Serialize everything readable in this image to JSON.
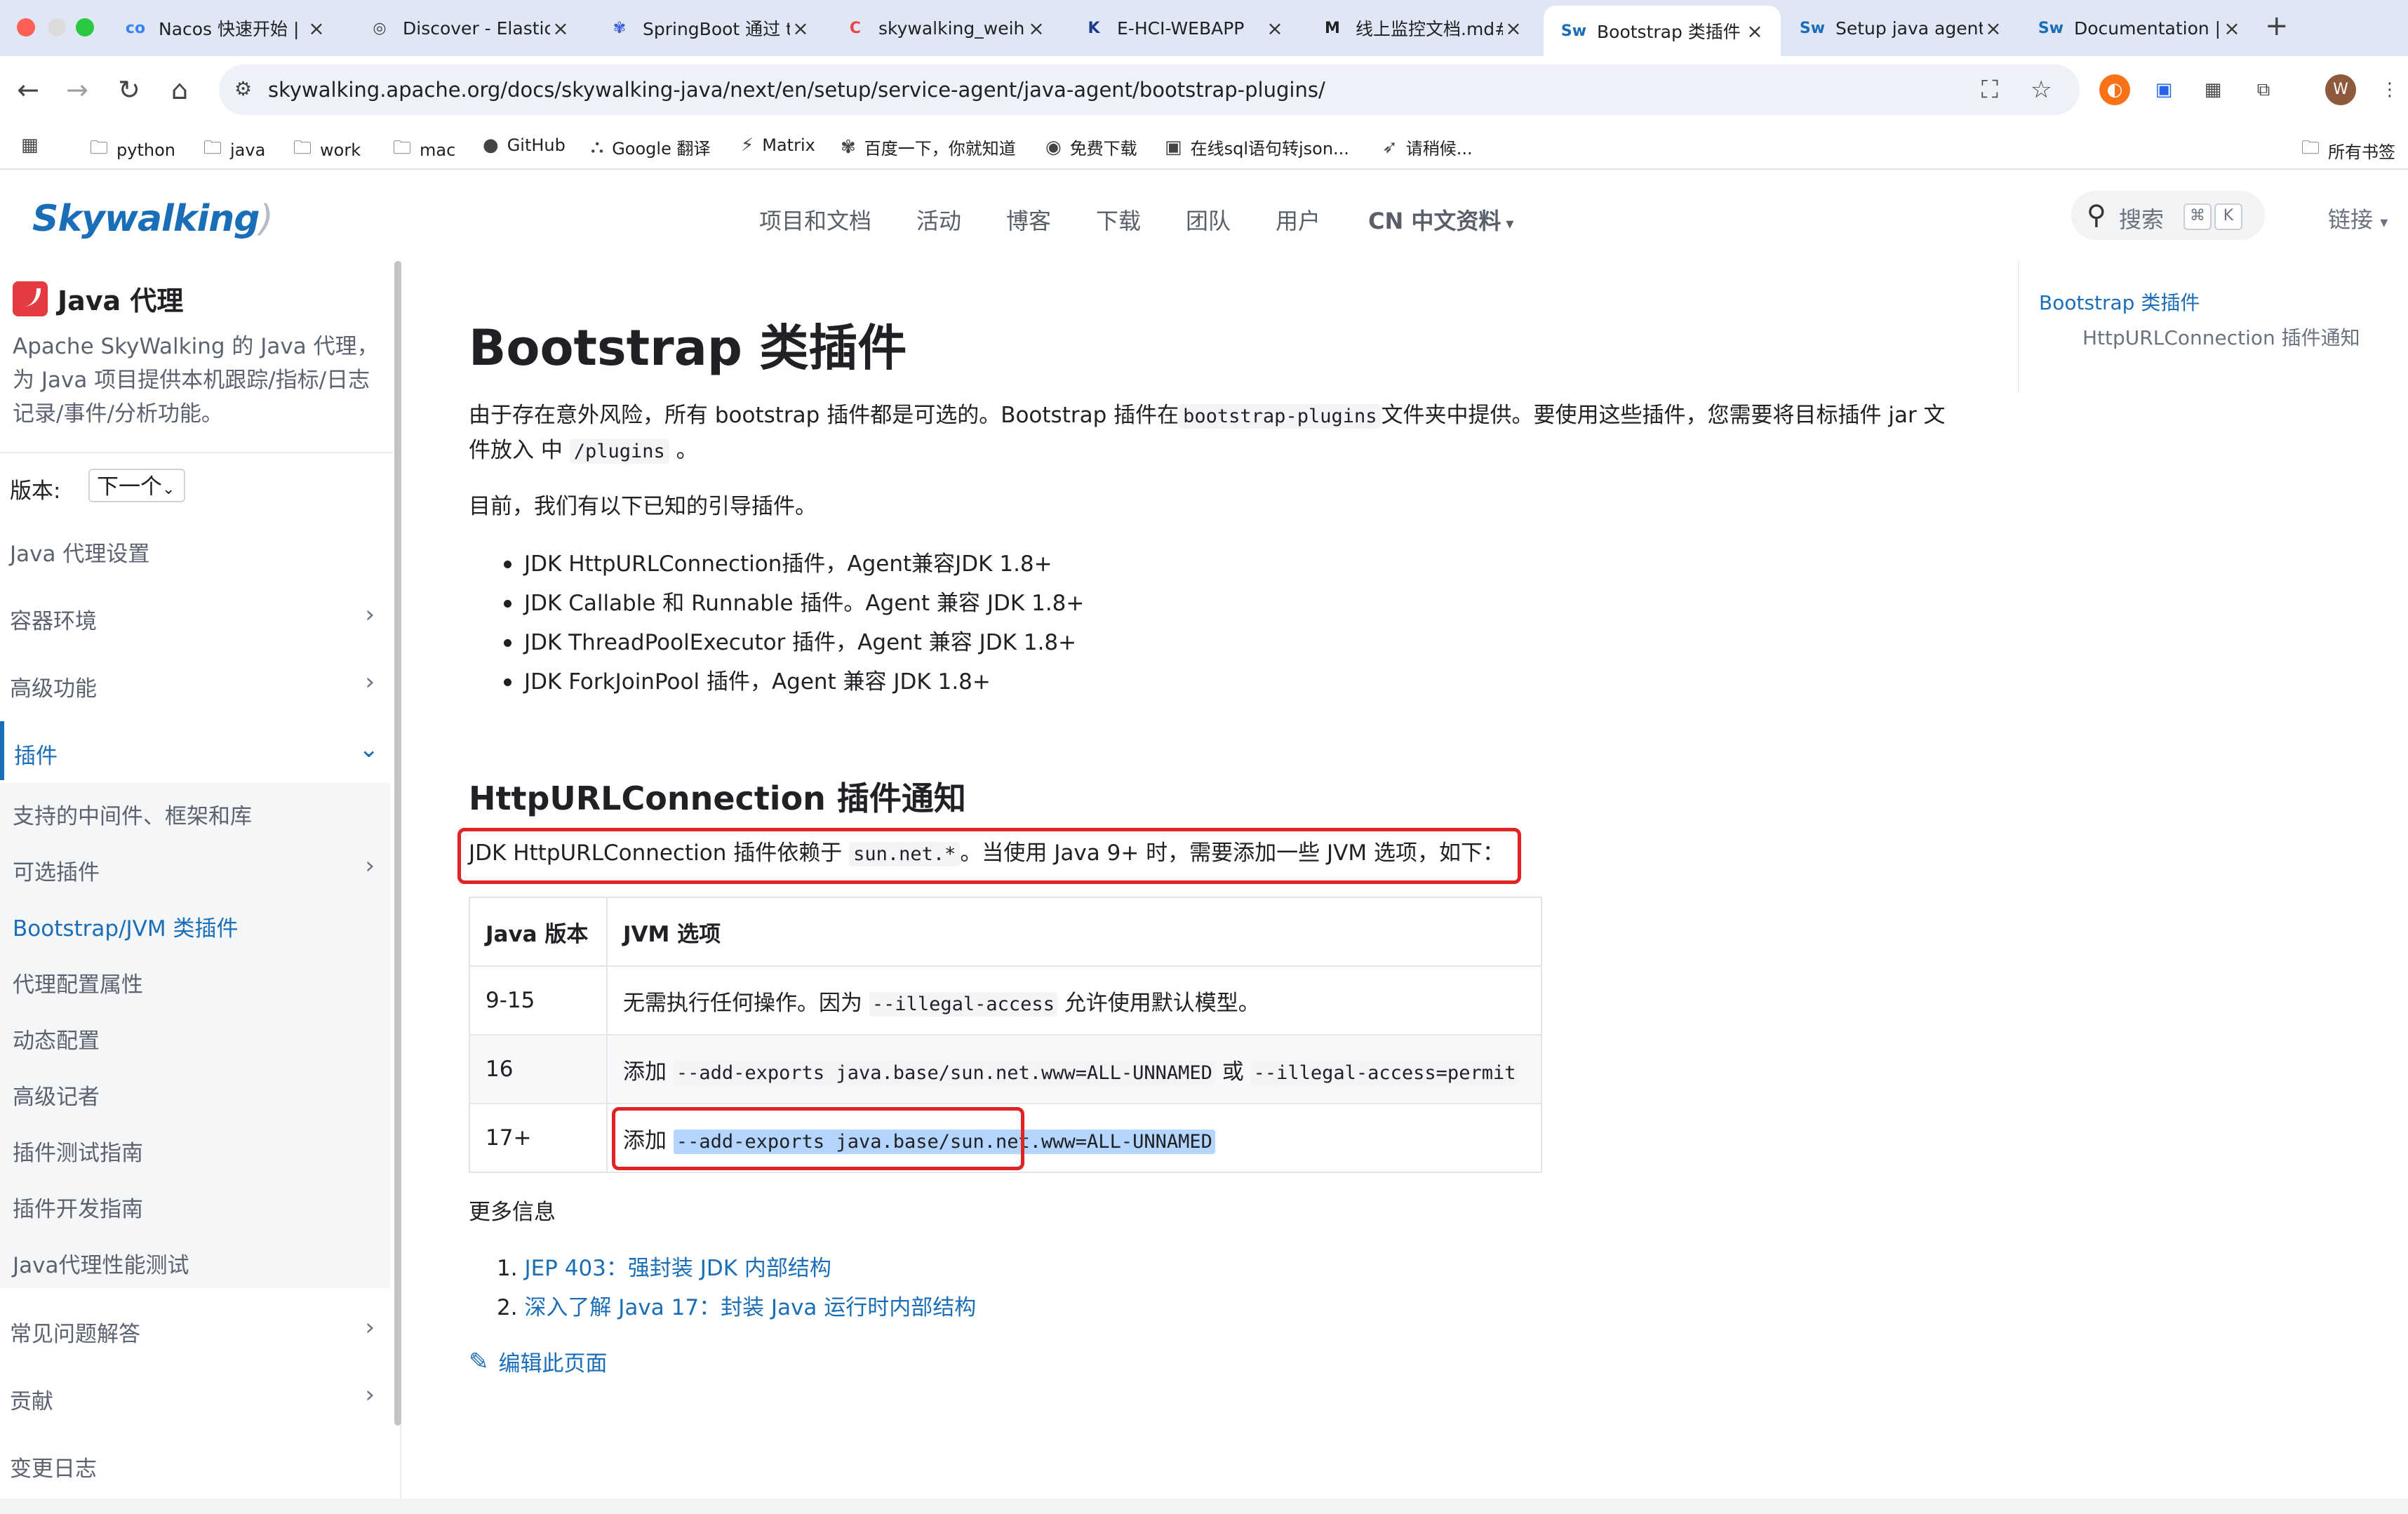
{
  "browser": {
    "tabs": [
      {
        "title": "Nacos 快速开始 | N",
        "favicon": "nacos-icon",
        "favicon_text": "co",
        "favicon_color": "#3b82f6",
        "active": false
      },
      {
        "title": "Discover - Elastic",
        "favicon": "elastic-icon",
        "favicon_text": "◎",
        "favicon_color": "#444444",
        "active": false
      },
      {
        "title": "SpringBoot 通过 t",
        "favicon": "baidu-icon",
        "favicon_text": "✾",
        "favicon_color": "#3b5bdb",
        "active": false
      },
      {
        "title": "skywalking_weihu",
        "favicon": "csdn-icon",
        "favicon_text": "C",
        "favicon_color": "#ef4444",
        "active": false
      },
      {
        "title": "E-HCI-WEBAPP",
        "favicon": "k-icon",
        "favicon_text": "K",
        "favicon_color": "#1e3a8a",
        "active": false
      },
      {
        "title": "线上监控文档.md#",
        "favicon": "m-icon",
        "favicon_text": "M",
        "favicon_color": "#202124",
        "active": false
      },
      {
        "title": "Bootstrap 类插件",
        "favicon": "sw-icon",
        "favicon_text": "Sw",
        "favicon_color": "#1a6eb8",
        "active": true
      },
      {
        "title": "Setup java agent",
        "favicon": "sw-icon",
        "favicon_text": "Sw",
        "favicon_color": "#1a6eb8",
        "active": false
      },
      {
        "title": "Documentation | A",
        "favicon": "sw-icon",
        "favicon_text": "Sw",
        "favicon_color": "#1a6eb8",
        "active": false
      }
    ],
    "url": "skywalking.apache.org/docs/skywalking-java/next/en/setup/service-agent/java-agent/bootstrap-plugins/",
    "profile_initial": "W",
    "bookmarks": [
      {
        "label": "python",
        "icon": "folder-icon"
      },
      {
        "label": "java",
        "icon": "folder-icon"
      },
      {
        "label": "work",
        "icon": "folder-icon"
      },
      {
        "label": "mac",
        "icon": "folder-icon"
      },
      {
        "label": "GitHub",
        "icon": "github-icon"
      },
      {
        "label": "Google 翻译",
        "icon": "translate-icon"
      },
      {
        "label": "Matrix",
        "icon": "matrix-icon"
      },
      {
        "label": "百度一下，你就知道",
        "icon": "baidu-icon"
      },
      {
        "label": "免费下载",
        "icon": "download-icon"
      },
      {
        "label": "在线sql语句转json...",
        "icon": "b-icon"
      },
      {
        "label": "请稍候...",
        "icon": "rocket-icon"
      }
    ],
    "all_bookmarks_label": "所有书签"
  },
  "site": {
    "logo_text": "Skywalking",
    "nav": [
      "项目和文档",
      "活动",
      "博客",
      "下载",
      "团队",
      "用户",
      "CN 中文资料"
    ],
    "search_placeholder": "搜索",
    "search_keys": [
      "⌘",
      "K"
    ],
    "links_label": "链接"
  },
  "sidebar": {
    "title": "Java 代理",
    "description": "Apache SkyWalking 的 Java 代理，为 Java 项目提供本机跟踪/指标/日志记录/事件/分析功能。",
    "version_label": "版本:",
    "version_value": "下一个",
    "items": [
      {
        "label": "Java 代理设置",
        "chevron": false,
        "active": false
      },
      {
        "label": "容器环境",
        "chevron": true,
        "active": false
      },
      {
        "label": "高级功能",
        "chevron": true,
        "active": false
      },
      {
        "label": "插件",
        "chevron": true,
        "active": true
      }
    ],
    "sub_items": [
      {
        "label": "支持的中间件、框架和库",
        "chevron": false,
        "current": false
      },
      {
        "label": "可选插件",
        "chevron": true,
        "current": false
      },
      {
        "label": "Bootstrap/JVM 类插件",
        "chevron": false,
        "current": true
      },
      {
        "label": "代理配置属性",
        "chevron": false,
        "current": false
      },
      {
        "label": "动态配置",
        "chevron": false,
        "current": false
      },
      {
        "label": "高级记者",
        "chevron": false,
        "current": false
      },
      {
        "label": "插件测试指南",
        "chevron": false,
        "current": false
      },
      {
        "label": "插件开发指南",
        "chevron": false,
        "current": false
      },
      {
        "label": "Java代理性能测试",
        "chevron": false,
        "current": false
      }
    ],
    "bottom_items": [
      {
        "label": "常见问题解答",
        "chevron": true
      },
      {
        "label": "贡献",
        "chevron": true
      },
      {
        "label": "变更日志",
        "chevron": false
      }
    ]
  },
  "content": {
    "title": "Bootstrap 类插件",
    "intro": {
      "part1": "由于存在意外风险，所有 bootstrap 插件都是可选的。Bootstrap 插件在",
      "code1": "bootstrap-plugins",
      "part2": "文件夹中提供。要使用这些插件，您需要将目标插件 jar 文",
      "part3": "件放入 中",
      "code2": "/plugins",
      "part4": "。"
    },
    "known_intro": "目前，我们有以下已知的引导插件。",
    "plugins": [
      "JDK HttpURLConnection插件，Agent兼容JDK 1.8+",
      "JDK Callable 和 Runnable 插件。Agent 兼容 JDK 1.8+",
      "JDK ThreadPoolExecutor 插件，Agent 兼容 JDK 1.8+",
      "JDK ForkJoinPool 插件，Agent 兼容 JDK 1.8+"
    ],
    "section_title": "HttpURLConnection 插件通知",
    "notice": {
      "part1": "JDK HttpURLConnection 插件依赖于",
      "code": "sun.net.*",
      "part2": "。当使用 Java 9+ 时，需要添加一些 JVM 选项，如下："
    },
    "table": {
      "headers": [
        "Java 版本",
        "JVM 选项"
      ],
      "rows": [
        {
          "version": "9-15",
          "prefix": "无需执行任何操作。因为",
          "code": "--illegal-access",
          "suffix": "允许使用默认模型。",
          "or": "",
          "code2": ""
        },
        {
          "version": "16",
          "prefix": "添加",
          "code": "--add-exports java.base/sun.net.www=ALL-UNNAMED",
          "suffix": "",
          "or": "或",
          "code2": "--illegal-access=permit"
        },
        {
          "version": "17+",
          "prefix": "添加",
          "code": "--add-exports java.base/sun.net.www=ALL-UNNAMED",
          "suffix": "",
          "or": "",
          "code2": ""
        }
      ]
    },
    "more_info": "更多信息",
    "references": [
      "JEP 403：强封装 JDK 内部结构",
      "深入了解 Java 17：封装 Java 运行时内部结构"
    ],
    "edit_link": "编辑此页面"
  },
  "toc": {
    "items": [
      "Bootstrap 类插件",
      "HttpURLConnection 插件通知"
    ]
  },
  "colors": {
    "accent": "#1a6eb8",
    "highlight_box": "#e02424",
    "selection": "#b4d5fe"
  }
}
